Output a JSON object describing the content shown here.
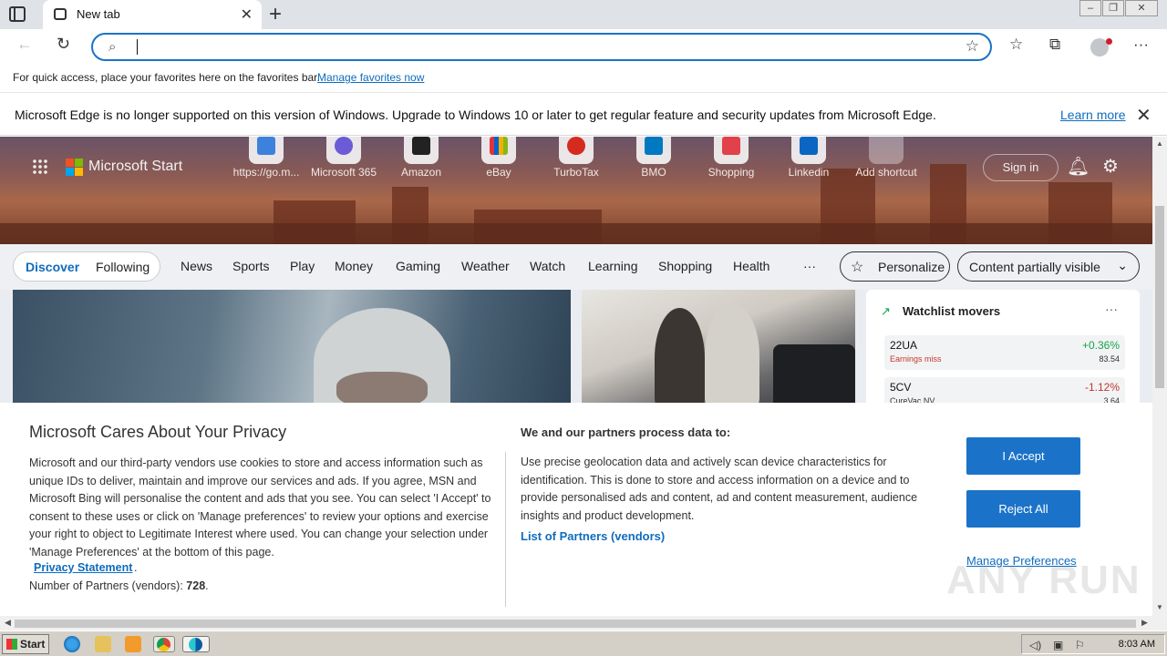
{
  "browser": {
    "tab_title": "New tab",
    "address_value": "",
    "favorites_bar": {
      "text": "For quick access, place your favorites here on the favorites bar.",
      "link": "Manage favorites now"
    },
    "info_bar": {
      "message": "Microsoft Edge is no longer supported on this version of Windows. Upgrade to Windows 10 or later to get regular feature and security updates from Microsoft Edge.",
      "link": "Learn more"
    }
  },
  "start_page": {
    "brand": "Microsoft Start",
    "shortcuts": [
      {
        "label": "https://go.m...",
        "color": "#3c82dc"
      },
      {
        "label": "Microsoft 365",
        "color": "#6b5bd6"
      },
      {
        "label": "Amazon",
        "color": "#222222"
      },
      {
        "label": "eBay",
        "color": "#e53238"
      },
      {
        "label": "TurboTax",
        "color": "#d52b1e"
      },
      {
        "label": "BMO",
        "color": "#0079c1"
      },
      {
        "label": "Shopping",
        "color": "#e0414b"
      },
      {
        "label": "Linkedin",
        "color": "#0a66c2"
      },
      {
        "label": "Add shortcut",
        "color": "#888888"
      }
    ],
    "sign_in": "Sign in",
    "nav_pill": {
      "discover": "Discover",
      "following": "Following"
    },
    "categories": [
      "News",
      "Sports",
      "Play",
      "Money",
      "Gaming",
      "Weather",
      "Watch",
      "Learning",
      "Shopping",
      "Health",
      "···"
    ],
    "personalize": "Personalize",
    "content_visibility": "Content partially visible",
    "watchlist": {
      "title": "Watchlist movers",
      "rows": [
        {
          "symbol": "22UA",
          "sub": "Earnings miss",
          "change": "+0.36%",
          "price": "83.54",
          "up": true
        },
        {
          "symbol": "5CV",
          "sub": "CureVac NV",
          "change": "-1.12%",
          "price": "3.64",
          "up": false
        }
      ]
    }
  },
  "consent": {
    "title": "Microsoft Cares About Your Privacy",
    "body": "Microsoft and our third-party vendors use cookies to store and access information such as unique IDs to deliver, maintain and improve our services and ads. If you agree, MSN and Microsoft Bing will personalise the content and ads that you see. You can select 'I Accept' to consent to these uses or click on 'Manage preferences' to review your options and exercise your right to object to Legitimate Interest where used.  You can change your selection under 'Manage Preferences' at the bottom of this page.",
    "privacy_link": "Privacy Statement",
    "partners_label": "Number of Partners (vendors): ",
    "partners_count": "728",
    "right_title": "We and our partners process data to:",
    "right_body": "Use precise geolocation data and actively scan device characteristics for identification. This is done to store and access information on a device and to provide personalised ads and content, ad and content measurement, audience insights and product development.",
    "partners_link": "List of Partners (vendors)",
    "accept": "I Accept",
    "reject": "Reject All",
    "manage": "Manage Preferences"
  },
  "watermark": "ANY RUN",
  "taskbar": {
    "start": "Start",
    "clock": "8:03 AM"
  }
}
